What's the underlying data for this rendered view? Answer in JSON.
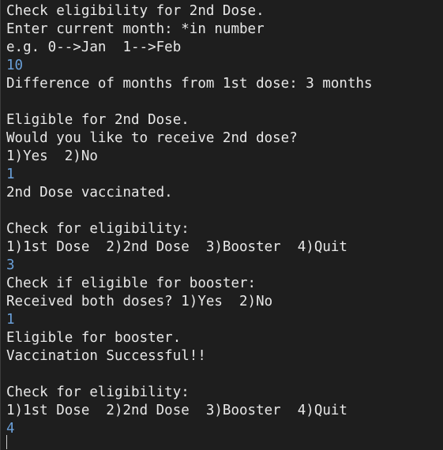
{
  "console": {
    "lines": [
      {
        "text": "Check eligibility for 2nd Dose.",
        "kind": "output"
      },
      {
        "text": "Enter current month: *in number",
        "kind": "output"
      },
      {
        "text": "e.g. 0-->Jan  1-->Feb",
        "kind": "output"
      },
      {
        "text": "10",
        "kind": "input"
      },
      {
        "text": "Difference of months from 1st dose: 3 months",
        "kind": "output"
      },
      {
        "text": "",
        "kind": "output"
      },
      {
        "text": "Eligible for 2nd Dose.",
        "kind": "output"
      },
      {
        "text": "Would you like to receive 2nd dose?",
        "kind": "output"
      },
      {
        "text": "1)Yes  2)No",
        "kind": "output"
      },
      {
        "text": "1",
        "kind": "input"
      },
      {
        "text": "2nd Dose vaccinated.",
        "kind": "output"
      },
      {
        "text": "",
        "kind": "output"
      },
      {
        "text": "Check for eligibility:",
        "kind": "output"
      },
      {
        "text": "1)1st Dose  2)2nd Dose  3)Booster  4)Quit",
        "kind": "output"
      },
      {
        "text": "3",
        "kind": "input"
      },
      {
        "text": "Check if eligible for booster:",
        "kind": "output"
      },
      {
        "text": "Received both doses? 1)Yes  2)No",
        "kind": "output"
      },
      {
        "text": "1",
        "kind": "input"
      },
      {
        "text": "Eligible for booster.",
        "kind": "output"
      },
      {
        "text": "Vaccination Successful!!",
        "kind": "output"
      },
      {
        "text": "",
        "kind": "output"
      },
      {
        "text": "Check for eligibility:",
        "kind": "output"
      },
      {
        "text": "1)1st Dose  2)2nd Dose  3)Booster  4)Quit",
        "kind": "output"
      },
      {
        "text": "4",
        "kind": "input"
      }
    ]
  },
  "colors": {
    "background": "#1e1e1e",
    "output_text": "#e8e8e8",
    "input_text": "#6a9fd8"
  }
}
